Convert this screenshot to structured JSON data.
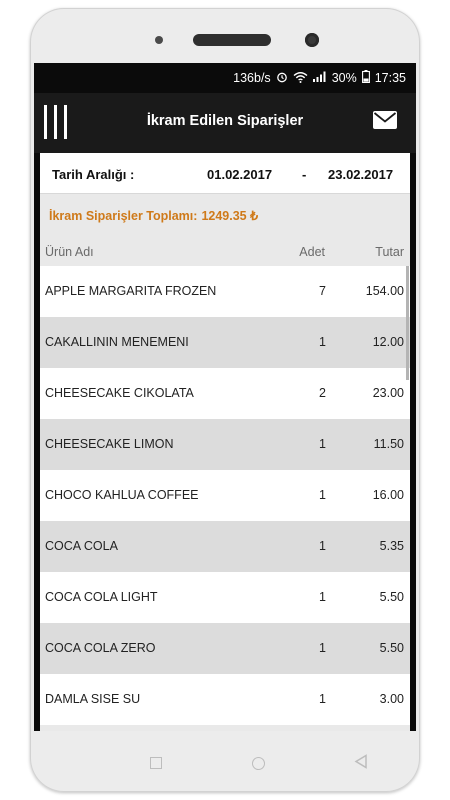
{
  "status_bar": {
    "speed": "136b/s",
    "battery": "30%",
    "time": "17:35"
  },
  "app_bar": {
    "title": "İkram Edilen Siparişler",
    "menu_icon": "menu-bars-icon",
    "mail_icon": "mail-icon"
  },
  "date_range": {
    "label": "Tarih Aralığı :",
    "start": "01.02.2017",
    "separator": "-",
    "end": "23.02.2017"
  },
  "total": {
    "label": "İkram Siparişler Toplamı:",
    "value": "1249.35 ₺",
    "color": "#cf7a1a"
  },
  "table": {
    "headers": {
      "name": "Ürün Adı",
      "qty": "Adet",
      "amount": "Tutar"
    },
    "rows": [
      {
        "name": "APPLE MARGARITA FROZEN",
        "qty": "7",
        "amount": "154.00"
      },
      {
        "name": "CAKALLININ MENEMENI",
        "qty": "1",
        "amount": "12.00"
      },
      {
        "name": "CHEESECAKE CIKOLATA",
        "qty": "2",
        "amount": "23.00"
      },
      {
        "name": "CHEESECAKE LIMON",
        "qty": "1",
        "amount": "11.50"
      },
      {
        "name": "CHOCO KAHLUA COFFEE",
        "qty": "1",
        "amount": "16.00"
      },
      {
        "name": "COCA COLA",
        "qty": "1",
        "amount": "5.35"
      },
      {
        "name": "COCA COLA LIGHT",
        "qty": "1",
        "amount": "5.50"
      },
      {
        "name": "COCA COLA ZERO",
        "qty": "1",
        "amount": "5.50"
      },
      {
        "name": "DAMLA SISE SU",
        "qty": "1",
        "amount": "3.00"
      }
    ]
  },
  "colors": {
    "app_bar": "#1a1a1a",
    "row_alt": "#dcdcdc",
    "accent": "#cf7a1a"
  }
}
